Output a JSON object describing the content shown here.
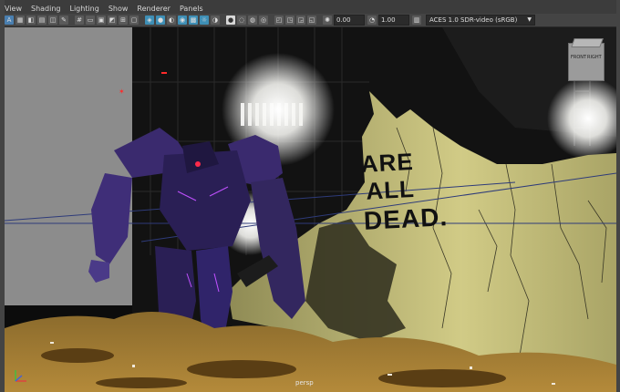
{
  "menu": {
    "items": [
      "View",
      "Shading",
      "Lighting",
      "Show",
      "Renderer",
      "Panels"
    ]
  },
  "toolbar": {
    "exposure_value": "0.00",
    "gamma_value": "1.00",
    "color_space": "ACES 1.0 SDR-video (sRGB)"
  },
  "viewport": {
    "camera_name": "persp",
    "viewcube_front": "FRONT",
    "viewcube_right": "RIGHT",
    "graffiti_line1": "ARE",
    "graffiti_line2": "ALL",
    "graffiti_line3": "DEAD."
  },
  "colors": {
    "viewport_bg": "#0c0c0c",
    "wall": "#c9c37a",
    "ground": "#7a5a22",
    "robot": "#3a2a6e",
    "accent_blue": "#4a7fb0"
  }
}
